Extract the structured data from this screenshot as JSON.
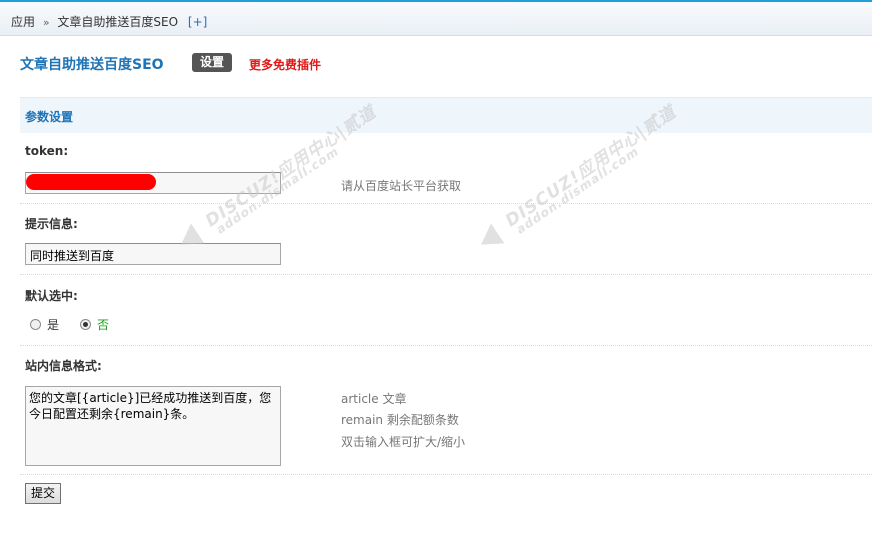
{
  "breadcrumb": {
    "root": "应用",
    "separator": "»",
    "current": "文章自助推送百度SEO",
    "add": "[+]"
  },
  "plugin": {
    "title": "文章自助推送百度SEO",
    "tab_settings": "设置",
    "more_plugins": "更多免费插件"
  },
  "section": {
    "title": "参数设置"
  },
  "fields": {
    "token": {
      "label": "token:",
      "value": "",
      "hint": "请从百度站长平台获取"
    },
    "notice": {
      "label": "提示信息:",
      "value": "同时推送到百度"
    },
    "default_selected": {
      "label": "默认选中:",
      "options": [
        "是",
        "否"
      ],
      "selected": "否"
    },
    "message_format": {
      "label": "站内信息格式:",
      "value": "您的文章[{article}]已经成功推送到百度，您今日配置还剩余{remain}条。",
      "hints": [
        "article 文章",
        "remain 剩余配额条数",
        "双击输入框可扩大/缩小"
      ]
    }
  },
  "submit_label": "提交",
  "watermark": {
    "brand": "DISCUZ!应用中心|贰道",
    "domain": "addon.dismall.com"
  },
  "colors": {
    "accent_blue": "#1f74b5",
    "link_red": "#e01818",
    "selected_green": "#1aa01a",
    "top_border": "#1e9fd6"
  }
}
